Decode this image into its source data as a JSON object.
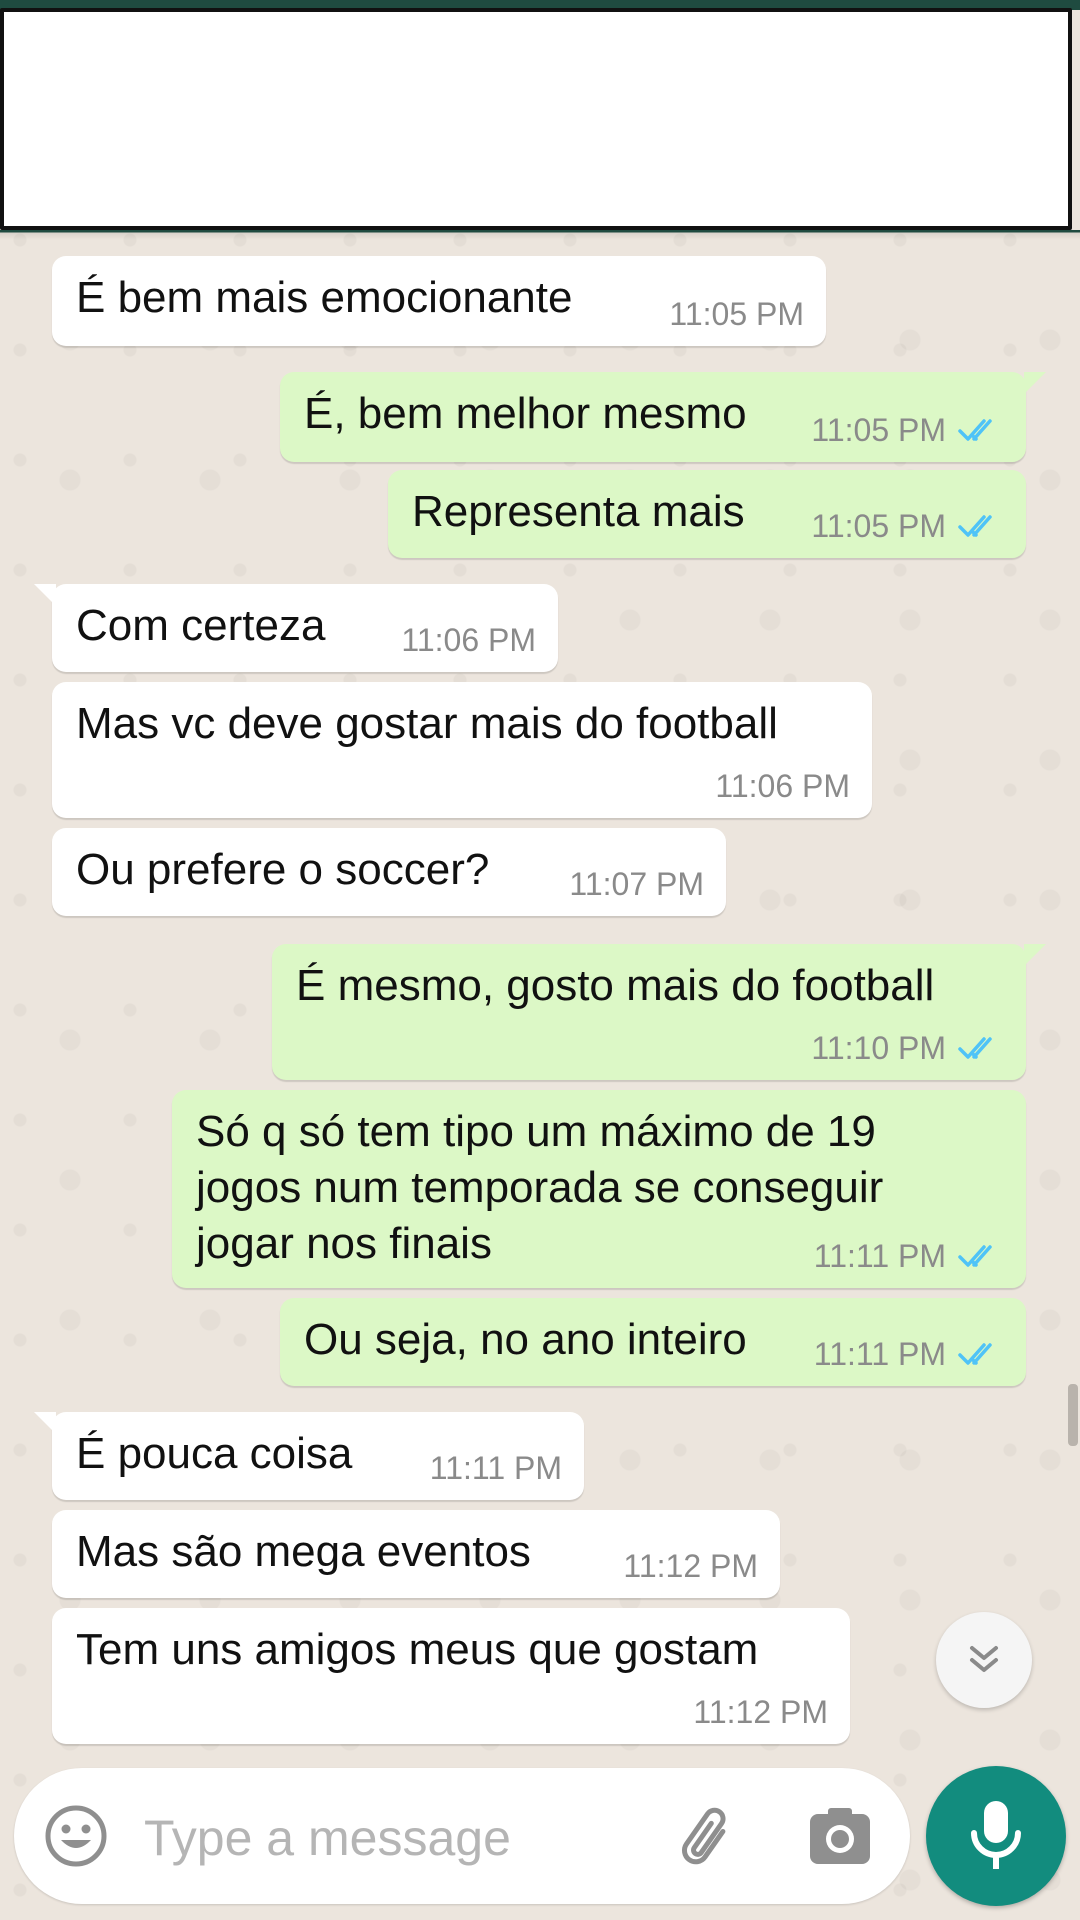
{
  "header": {
    "redacted": true
  },
  "messages": [
    {
      "dir": "in",
      "text": "É bem mais emocionante",
      "time": "11:05 PM"
    },
    {
      "dir": "out",
      "text": "É, bem melhor mesmo",
      "time": "11:05 PM",
      "status": "read"
    },
    {
      "dir": "out",
      "text": "Representa mais",
      "time": "11:05 PM",
      "status": "read"
    },
    {
      "dir": "in",
      "text": "Com certeza",
      "time": "11:06 PM"
    },
    {
      "dir": "in",
      "text": "Mas vc deve gostar mais do football",
      "time": "11:06 PM"
    },
    {
      "dir": "in",
      "text": "Ou prefere o soccer?",
      "time": "11:07 PM"
    },
    {
      "dir": "out",
      "text": "É mesmo, gosto mais do football",
      "time": "11:10 PM",
      "status": "read"
    },
    {
      "dir": "out",
      "text": "Só q só tem tipo um máximo de 19 jogos num temporada se conseguir jogar nos finais",
      "lines": [
        "Só q só tem tipo um máximo de 19",
        "jogos num temporada se conseguir",
        "jogar nos finais"
      ],
      "time": "11:11 PM",
      "status": "read"
    },
    {
      "dir": "out",
      "text": "Ou seja, no ano inteiro",
      "time": "11:11 PM",
      "status": "read"
    },
    {
      "dir": "in",
      "text": "É pouca coisa",
      "time": "11:11 PM"
    },
    {
      "dir": "in",
      "text": "Mas são mega eventos",
      "time": "11:12 PM"
    },
    {
      "dir": "in",
      "text": "Tem uns amigos meus que gostam",
      "time": "11:12 PM"
    }
  ],
  "composer": {
    "placeholder": "Type a message",
    "icons": [
      "emoji-icon",
      "attach-icon",
      "camera-icon"
    ]
  },
  "mic_icon": "microphone-icon",
  "scroll_down_icon": "double-chevron-down-icon",
  "colors": {
    "incoming": "#ffffff",
    "outgoing": "#dcf8c6",
    "read_ticks": "#4fc3f7",
    "accent": "#128c7e",
    "timestamp": "#8a8a8a"
  }
}
